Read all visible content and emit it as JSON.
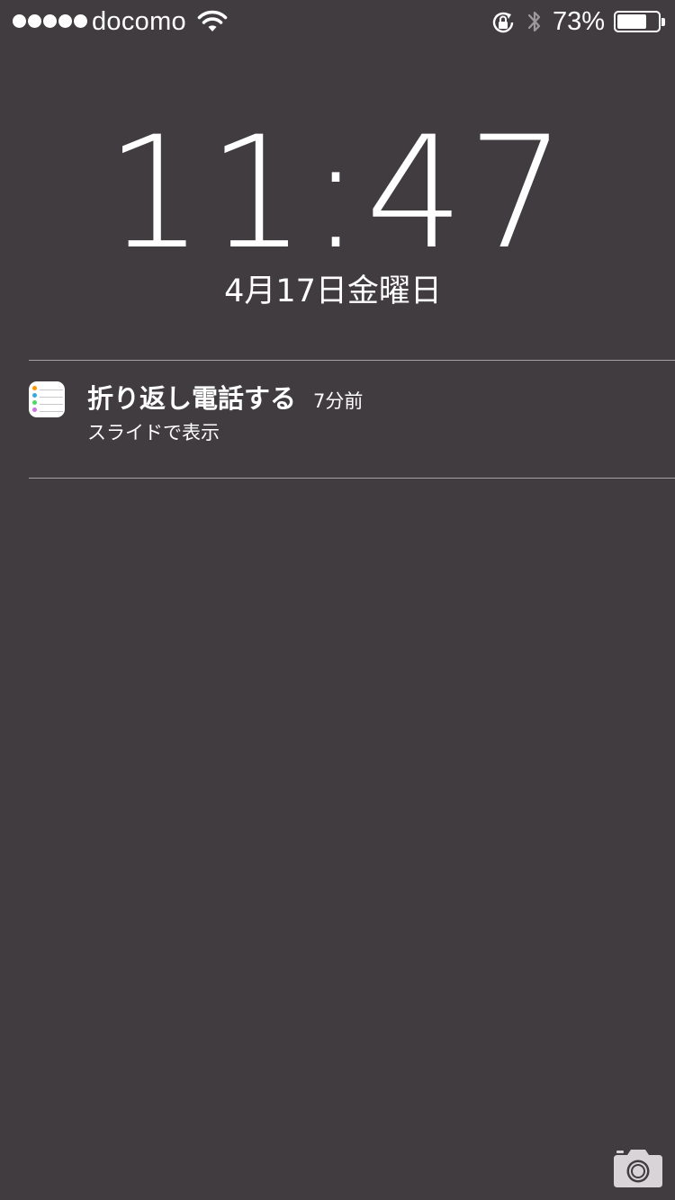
{
  "status_bar": {
    "signal_dots": 5,
    "carrier": "docomo",
    "battery_percent_label": "73%",
    "battery_level": 0.73
  },
  "lock_screen": {
    "time": "11:47",
    "date": "4月17日金曜日"
  },
  "notification": {
    "app_icon": "reminders-icon",
    "title": "折り返し電話する",
    "time_ago": "7分前",
    "action_hint": "スライドで表示"
  },
  "camera": {
    "icon": "camera-icon"
  },
  "colors": {
    "background": "#403c40",
    "text": "#ffffff",
    "divider": "#a5a1a5",
    "camera_icon": "#d8d4d8",
    "reminder_bullets": [
      "#ff9500",
      "#34aadc",
      "#4cd964",
      "#cc73e1"
    ]
  }
}
